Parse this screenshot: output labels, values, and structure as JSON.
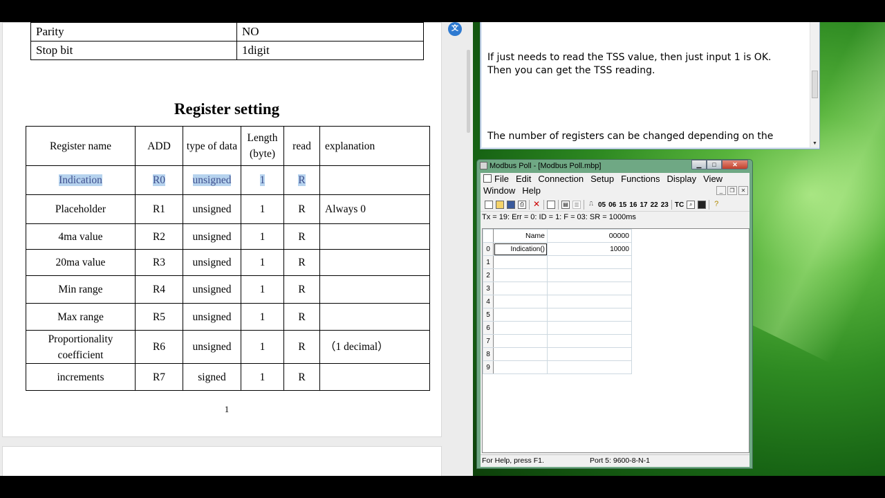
{
  "document": {
    "config_rows": [
      {
        "label": "Parity",
        "value": "NO"
      },
      {
        "label": "Stop bit",
        "value": "1digit"
      }
    ],
    "section_title": "Register setting",
    "register_headers": [
      "Register name",
      "ADD",
      "type of data",
      "Length (byte)",
      "read",
      "explanation"
    ],
    "registers": [
      {
        "name": "Indication",
        "add": "R0",
        "type": "unsigned",
        "length": "1",
        "read": "R",
        "explanation": ""
      },
      {
        "name": "Placeholder",
        "add": "R1",
        "type": "unsigned",
        "length": "1",
        "read": "R",
        "explanation": "Always 0"
      },
      {
        "name": "4ma value",
        "add": "R2",
        "type": "unsigned",
        "length": "1",
        "read": "R",
        "explanation": ""
      },
      {
        "name": "20ma value",
        "add": "R3",
        "type": "unsigned",
        "length": "1",
        "read": "R",
        "explanation": ""
      },
      {
        "name": "Min range",
        "add": "R4",
        "type": "unsigned",
        "length": "1",
        "read": "R",
        "explanation": ""
      },
      {
        "name": "Max range",
        "add": "R5",
        "type": "unsigned",
        "length": "1",
        "read": "R",
        "explanation": ""
      },
      {
        "name": "Proportionality coefficient",
        "add": "R6",
        "type": "unsigned",
        "length": "1",
        "read": "R",
        "explanation": "（1 decimal）"
      },
      {
        "name": "increments",
        "add": "R7",
        "type": "signed",
        "length": "1",
        "read": "R",
        "explanation": ""
      }
    ],
    "page_number": "1",
    "float_button_icon": "translate-icon"
  },
  "notepad": {
    "line1": "If just needs to read the TSS value, then just input 1 is OK.",
    "line2": "Then you can get the TSS reading.",
    "line3": "The number of registers can be changed depending on the"
  },
  "modbus": {
    "title": "Modbus Poll - [Modbus Poll.mbp]",
    "menu_row1": [
      "File",
      "Edit",
      "Connection",
      "Setup",
      "Functions",
      "Display",
      "View"
    ],
    "menu_row2": [
      "Window",
      "Help"
    ],
    "toolbar_codes": [
      "05",
      "06",
      "15",
      "16",
      "17",
      "22",
      "23",
      "TC"
    ],
    "status": "Tx = 19: Err = 0: ID = 1: F = 03: SR = 1000ms",
    "grid_header": {
      "name": "Name",
      "value": "00000"
    },
    "grid_rows": [
      {
        "row": "0",
        "name": "Indication()",
        "value": "10000"
      },
      {
        "row": "1",
        "name": "",
        "value": ""
      },
      {
        "row": "2",
        "name": "",
        "value": ""
      },
      {
        "row": "3",
        "name": "",
        "value": ""
      },
      {
        "row": "4",
        "name": "",
        "value": ""
      },
      {
        "row": "5",
        "name": "",
        "value": ""
      },
      {
        "row": "6",
        "name": "",
        "value": ""
      },
      {
        "row": "7",
        "name": "",
        "value": ""
      },
      {
        "row": "8",
        "name": "",
        "value": ""
      },
      {
        "row": "9",
        "name": "",
        "value": ""
      }
    ],
    "statusbar_left": "For Help, press F1.",
    "statusbar_right": "Port 5: 9600-8-N-1"
  }
}
